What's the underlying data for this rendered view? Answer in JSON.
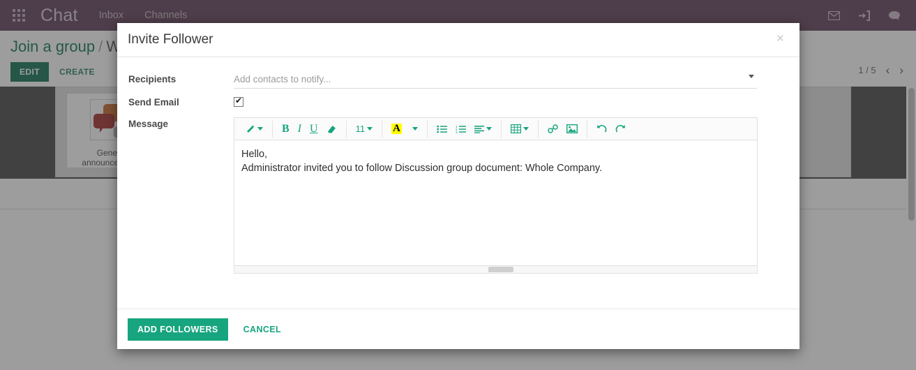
{
  "navbar": {
    "apps_icon": "apps-grid-icon",
    "brand": "Chat",
    "links": [
      {
        "label": "Inbox",
        "name": "nav-inbox"
      },
      {
        "label": "Channels",
        "name": "nav-channels"
      }
    ],
    "right_icons": [
      {
        "name": "mail-icon",
        "glyph": "✉"
      },
      {
        "name": "sign-in-icon",
        "glyph": "➡"
      },
      {
        "name": "messaging-icon",
        "glyph": "💬"
      }
    ]
  },
  "control_panel": {
    "breadcrumb_root": "Join a group",
    "breadcrumb_sep": "/",
    "breadcrumb_current": "Whole Company",
    "edit_label": "EDIT",
    "create_label": "CREATE",
    "pager_text": "1 / 5",
    "pager_prev": "‹",
    "pager_next": "›"
  },
  "content": {
    "card_label": "General announcements",
    "card_thumb": "chat-bubbles-image"
  },
  "modal": {
    "title": "Invite Follower",
    "close_glyph": "×",
    "fields": {
      "recipients_label": "Recipients",
      "recipients_value": "",
      "recipients_placeholder": "Add contacts to notify...",
      "send_email_label": "Send Email",
      "send_email_checked": true,
      "message_label": "Message"
    },
    "editor": {
      "toolbar": [
        {
          "name": "style-magicwand-button",
          "glyph": "✐",
          "caret": true
        },
        {
          "name": "bold-button",
          "glyph": "B",
          "caret": false
        },
        {
          "name": "italic-button",
          "glyph": "I",
          "caret": false
        },
        {
          "name": "underline-button",
          "glyph": "U",
          "caret": false
        },
        {
          "name": "clear-formatting-button",
          "glyph": "▰",
          "caret": false
        },
        {
          "name": "font-size-button",
          "glyph": "11",
          "caret": true
        },
        {
          "name": "text-highlight-button",
          "glyph": "A",
          "caret": true
        },
        {
          "name": "unordered-list-button",
          "glyph": "≡",
          "caret": false
        },
        {
          "name": "ordered-list-button",
          "glyph": "≣",
          "caret": false
        },
        {
          "name": "paragraph-align-button",
          "glyph": "≡",
          "caret": true
        },
        {
          "name": "table-button",
          "glyph": "⊞",
          "caret": true
        },
        {
          "name": "link-button",
          "glyph": "⚭",
          "caret": false
        },
        {
          "name": "image-button",
          "glyph": "⛰",
          "caret": false
        },
        {
          "name": "undo-button",
          "glyph": "↺",
          "caret": false
        },
        {
          "name": "redo-button",
          "glyph": "↻",
          "caret": false
        }
      ],
      "font_size_value": "11",
      "body_line1": "Hello,",
      "body_line2": "Administrator invited you to follow Discussion group document: Whole Company."
    },
    "footer": {
      "submit_label": "ADD FOLLOWERS",
      "cancel_label": "CANCEL"
    }
  },
  "colors": {
    "navbar_bg": "#58344f",
    "accent_green": "#17a57f",
    "dark_green": "#00694a",
    "overlay": "rgba(70,70,70,0.53)"
  }
}
